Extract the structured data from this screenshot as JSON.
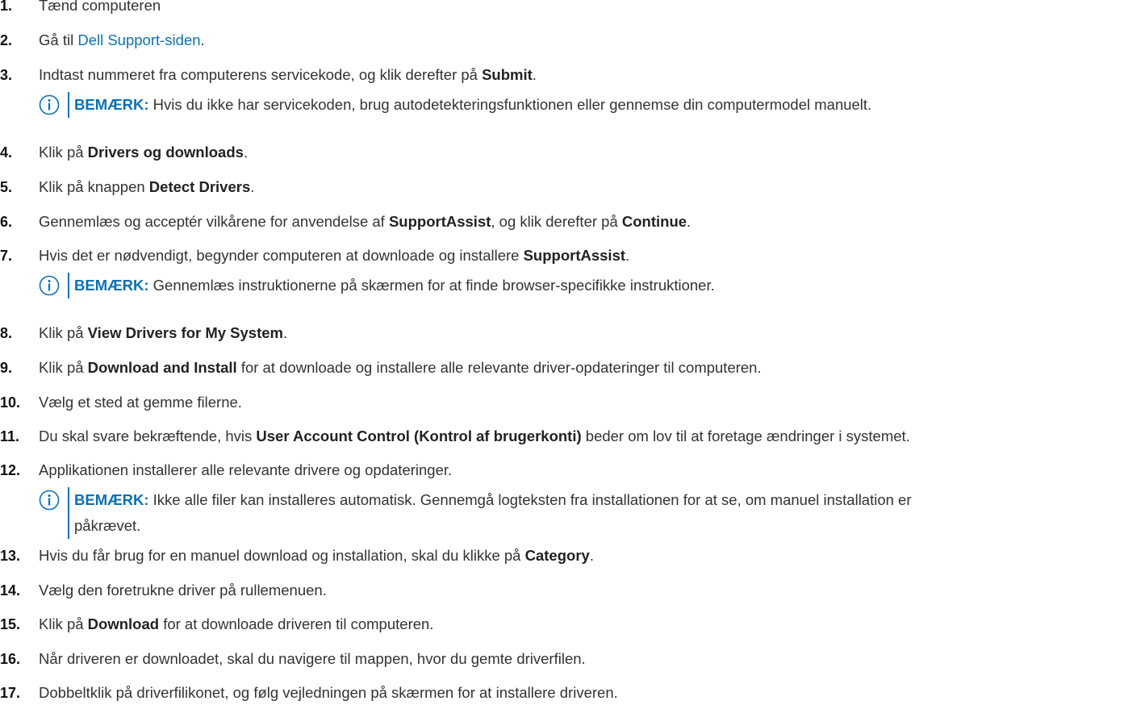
{
  "steps": [
    {
      "num": "1.",
      "segments": [
        {
          "t": "Tænd computeren"
        }
      ]
    },
    {
      "num": "2.",
      "segments": [
        {
          "t": "Gå til "
        },
        {
          "t": "Dell Support-siden",
          "link": true
        },
        {
          "t": "."
        }
      ]
    },
    {
      "num": "3.",
      "segments": [
        {
          "t": "Indtast nummeret fra computerens servicekode, og klik derefter på "
        },
        {
          "t": "Submit",
          "b": true
        },
        {
          "t": "."
        }
      ],
      "note": {
        "label": "BEMÆRK:",
        "text": " Hvis du ikke har servicekoden, brug autodetekteringsfunktionen eller gennemse din computermodel manuelt."
      }
    },
    {
      "num": "4.",
      "segments": [
        {
          "t": "Klik på "
        },
        {
          "t": "Drivers og downloads",
          "b": true
        },
        {
          "t": "."
        }
      ]
    },
    {
      "num": "5.",
      "segments": [
        {
          "t": "Klik på knappen "
        },
        {
          "t": "Detect Drivers",
          "b": true
        },
        {
          "t": "."
        }
      ]
    },
    {
      "num": "6.",
      "segments": [
        {
          "t": "Gennemlæs og acceptér vilkårene for anvendelse af "
        },
        {
          "t": "SupportAssist",
          "b": true
        },
        {
          "t": ", og klik derefter på "
        },
        {
          "t": "Continue",
          "b": true
        },
        {
          "t": "."
        }
      ]
    },
    {
      "num": "7.",
      "segments": [
        {
          "t": "Hvis det er nødvendigt, begynder computeren at downloade og installere "
        },
        {
          "t": "SupportAssist",
          "b": true
        },
        {
          "t": "."
        }
      ],
      "note": {
        "label": "BEMÆRK:",
        "text": " Gennemlæs instruktionerne på skærmen for at finde browser-specifikke instruktioner."
      }
    },
    {
      "num": "8.",
      "segments": [
        {
          "t": "Klik på "
        },
        {
          "t": "View Drivers for My System",
          "b": true
        },
        {
          "t": "."
        }
      ]
    },
    {
      "num": "9.",
      "segments": [
        {
          "t": "Klik på "
        },
        {
          "t": "Download and Install",
          "b": true
        },
        {
          "t": " for at downloade og installere alle relevante driver-opdateringer til computeren."
        }
      ]
    },
    {
      "num": "10.",
      "segments": [
        {
          "t": "Vælg et sted at gemme filerne."
        }
      ]
    },
    {
      "num": "11.",
      "segments": [
        {
          "t": "Du skal svare bekræftende, hvis "
        },
        {
          "t": "User Account Control (Kontrol af brugerkonti)",
          "b": true
        },
        {
          "t": " beder om lov til at foretage ændringer i systemet."
        }
      ]
    },
    {
      "num": "12.",
      "segments": [
        {
          "t": "Applikationen installerer alle relevante drivere og opdateringer."
        }
      ],
      "note": {
        "label": "BEMÆRK:",
        "text": " Ikke alle filer kan installeres automatisk. Gennemgå logteksten fra installationen for at se, om manuel installation er",
        "text2": "påkrævet."
      }
    },
    {
      "num": "13.",
      "segments": [
        {
          "t": "Hvis du får brug for en manuel download og installation, skal du klikke på "
        },
        {
          "t": "Category",
          "b": true
        },
        {
          "t": "."
        }
      ]
    },
    {
      "num": "14.",
      "segments": [
        {
          "t": "Vælg den foretrukne driver på rullemenuen."
        }
      ]
    },
    {
      "num": "15.",
      "segments": [
        {
          "t": "Klik på "
        },
        {
          "t": "Download",
          "b": true
        },
        {
          "t": " for at downloade driveren til computeren."
        }
      ]
    },
    {
      "num": "16.",
      "segments": [
        {
          "t": "Når driveren er downloadet, skal du navigere til mappen, hvor du gemte driverfilen."
        }
      ]
    },
    {
      "num": "17.",
      "segments": [
        {
          "t": "Dobbeltklik på driverfilikonet, og følg vejledningen på skærmen for at installere driveren."
        }
      ]
    }
  ]
}
